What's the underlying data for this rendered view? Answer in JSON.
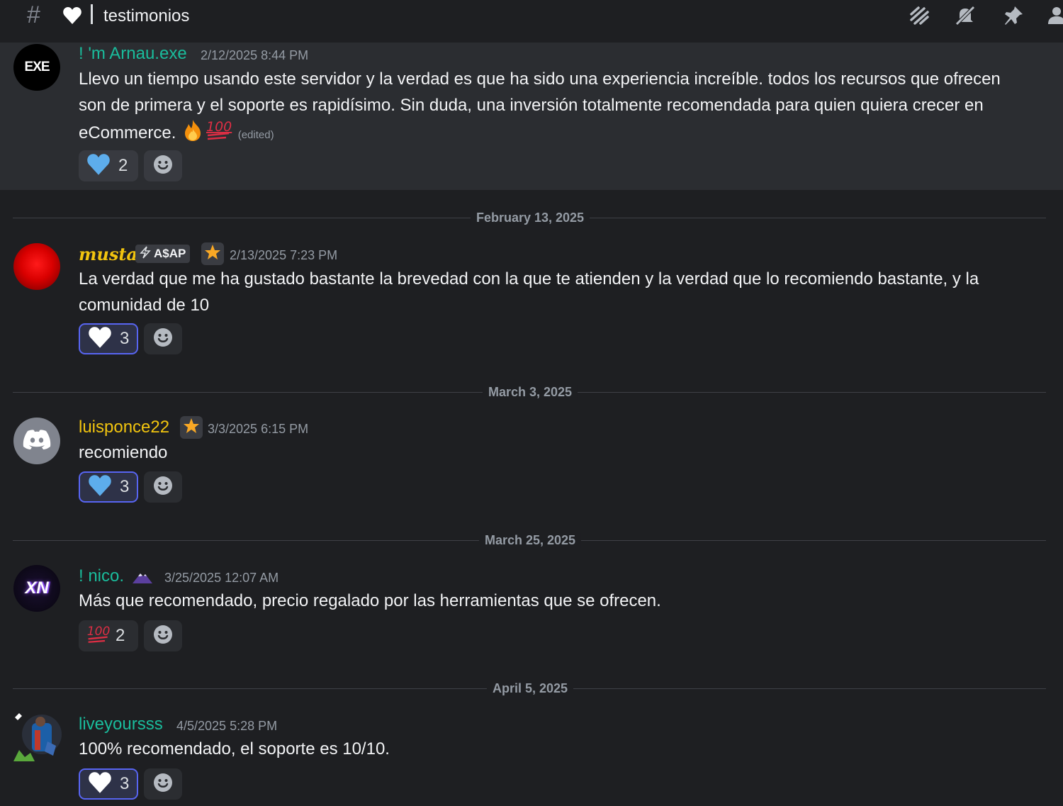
{
  "channel": {
    "name": "testimonios"
  },
  "header_icons": [
    "threads-icon",
    "notifications-muted-icon",
    "pin-icon",
    "member-list-icon"
  ],
  "messages": [
    {
      "username": "! 'm Arnau.exe",
      "avatar_label": "EXE",
      "timestamp": "2/12/2025 8:44 PM",
      "text": "Llevo un tiempo usando este servidor y la verdad es que ha sido una experiencia increíble. todos los recursos que ofrecen son de primera y el soporte es rapidísimo. Sin duda, una inversión totalmente recomendada para quien quiera crecer en eCommerce.",
      "edited": "(edited)",
      "reaction_count": "2",
      "name_color": "#1abc9c"
    },
    {
      "date_divider": "February 13, 2025",
      "username": "musta",
      "tag": "A$AP",
      "timestamp": "2/13/2025 7:23 PM",
      "text": "La verdad que me ha gustado bastante la brevedad con la que te atienden y la verdad que lo recomiendo bastante, y la comunidad de 10",
      "reaction_count": "3",
      "name_color": "#f1c40f"
    },
    {
      "date_divider": "March 3, 2025",
      "username": "luisponce22",
      "timestamp": "3/3/2025 6:15 PM",
      "text": "recomiendo",
      "reaction_count": "3",
      "name_color": "#f1c40f"
    },
    {
      "date_divider": "March 25, 2025",
      "username": "! nico.",
      "avatar_label": "XN",
      "timestamp": "3/25/2025 12:07 AM",
      "text": "Más que recomendado, precio regalado por las herramientas que se ofrecen.",
      "reaction_count": "2",
      "name_color": "#1abc9c"
    },
    {
      "date_divider": "April 5, 2025",
      "username": "liveyoursss",
      "timestamp": "4/5/2025 5:28 PM",
      "text": "100% recomendado, el soporte es 10/10.",
      "reaction_count": "3",
      "name_color": "#1abc9c"
    }
  ]
}
